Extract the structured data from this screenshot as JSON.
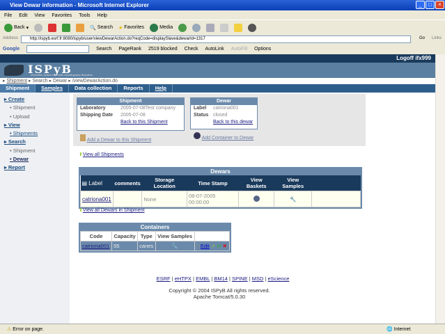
{
  "window": {
    "title": "View Dewar information - Microsoft Internet Explorer"
  },
  "menu": [
    "File",
    "Edit",
    "View",
    "Favorites",
    "Tools",
    "Help"
  ],
  "toolbar": {
    "back": "Back",
    "search": "Search",
    "favorites": "Favorites",
    "media": "Media"
  },
  "address": {
    "label": "Address",
    "url": "http://ispyb.esrf.fr:8080/ispyb/user/viewDewarAction.do?reqCode=displaySlave&dewarId=1317",
    "go": "Go",
    "links": "Links"
  },
  "google": {
    "brand": "Google",
    "search": "Search",
    "pagerank": "PageRank",
    "blocked": "2519 blocked",
    "check": "Check",
    "autolink": "AutoLink",
    "autofill": "AutoFill",
    "options": "Options"
  },
  "header": {
    "logoff": "Logoff ifx999",
    "logo": "ISPyB",
    "tagline": "Information System for Protein crystallography Beamlines"
  },
  "breadcrumb": [
    "Shipment",
    "Search",
    "Dewar",
    "/viewDewarAction.do"
  ],
  "tabs": [
    "Shipment",
    "Samples",
    "Data collection",
    "Reports",
    "Help"
  ],
  "sidebar": [
    {
      "label": "Create",
      "children": [
        "Shipment",
        "Upload"
      ]
    },
    {
      "label": "View",
      "children": [
        "Shipments"
      ]
    },
    {
      "label": "Search",
      "children": [
        "Shipment",
        "Dewar"
      ]
    },
    {
      "label": "Report",
      "children": []
    }
  ],
  "shipment": {
    "title": "Shipment",
    "lab_label": "Laboratory",
    "lab": "2005-07-08Test company",
    "date_label": "Shipping Date",
    "date": "2005-07-08",
    "back": "Back to this Shipment",
    "add": "Add a Dewar to this Shipment"
  },
  "dewar": {
    "title": "Dewar",
    "label_label": "Label",
    "label": "catriona001",
    "status_label": "Status",
    "status": "closed",
    "back": "Back to this dewar",
    "add": "Add Container to Dewar"
  },
  "view_all_shipments": "View all Shipments",
  "dewars": {
    "title": "Dewars",
    "columns": [
      "Label",
      "comments",
      "Storage Location",
      "Time Stamp",
      "View Baskets",
      "View Samples"
    ],
    "rows": [
      {
        "label": "catriona001",
        "comments": "",
        "storage": "None",
        "timestamp": "08-07-2005 00:00:00"
      }
    ]
  },
  "view_all_dewars": "View all Dewars in Shipment",
  "containers": {
    "title": "Containers",
    "columns": [
      "Code",
      "Capacity",
      "Type",
      "View Samples"
    ],
    "rows": [
      {
        "code": "catriona001",
        "capacity": "55",
        "type": "canes",
        "edit": "Edit"
      }
    ]
  },
  "footer": {
    "links": [
      "ESRF",
      "eHTPX",
      "EMBL",
      "BM14",
      "SPINE",
      "MSD",
      "eScience"
    ],
    "copyright": "Copyright © 2004 ISPyB All rights reserved.",
    "server": "Apache Tomcat/5.0.30"
  },
  "status": {
    "text": "Error on page.",
    "zone": "Internet"
  }
}
